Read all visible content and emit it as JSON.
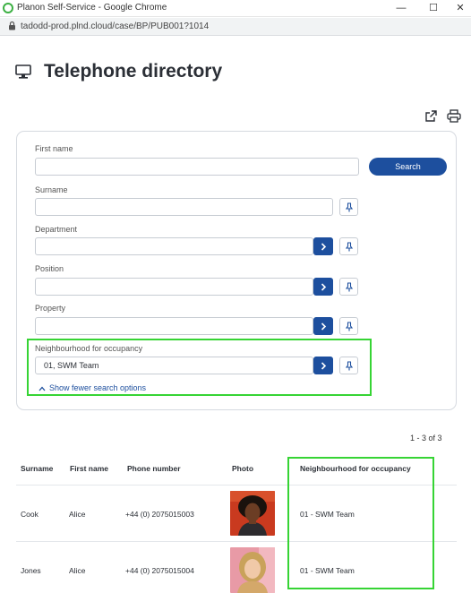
{
  "window": {
    "title": "Planon Self-Service - Google Chrome",
    "url": "tadodd-prod.plnd.cloud/case/BP/PUB001?1014",
    "controls": {
      "minimize": "—",
      "maximize": "☐",
      "close": "✕"
    }
  },
  "page": {
    "title": "Telephone directory"
  },
  "search": {
    "first_name_label": "First name",
    "first_name_value": "",
    "surname_label": "Surname",
    "surname_value": "",
    "department_label": "Department",
    "department_value": "",
    "position_label": "Position",
    "position_value": "",
    "property_label": "Property",
    "property_value": "",
    "neighbourhood_label": "Neighbourhood for occupancy",
    "neighbourhood_value": "01, SWM Team",
    "search_button": "Search",
    "fewer_options": "Show fewer search options"
  },
  "results": {
    "count": "1 - 3 of 3",
    "columns": [
      "Surname",
      "First name",
      "Phone number",
      "Photo",
      "Neighbourhood for occupancy"
    ],
    "rows": [
      {
        "surname": "Cook",
        "first_name": "Alice",
        "phone": "+44 (0) 2075015003",
        "neighbourhood": "01 - SWM Team"
      },
      {
        "surname": "Jones",
        "first_name": "Alice",
        "phone": "+44 (0) 2075015004",
        "neighbourhood": "01 - SWM Team"
      }
    ]
  },
  "colors": {
    "accent": "#1d4f9e",
    "highlight": "#36d434"
  },
  "icons": [
    "monitor-icon",
    "external-link-icon",
    "print-icon",
    "chevron-right-icon",
    "pin-icon",
    "chevron-up-icon",
    "lock-icon"
  ]
}
